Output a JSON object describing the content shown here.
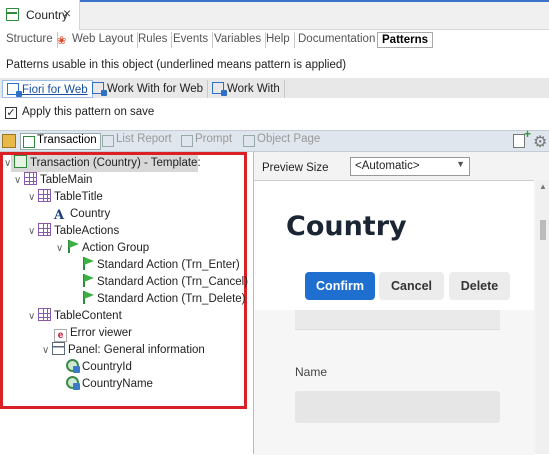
{
  "document_tab": {
    "title": "Country",
    "close_icon": "×"
  },
  "designer_tabs": [
    "Structure",
    "Web Layout",
    "Rules",
    "Events",
    "Variables",
    "Help",
    "Documentation",
    "Patterns"
  ],
  "patterns_caption": "Patterns usable in this object (underlined means pattern is applied)",
  "pattern_tabs": [
    "Fiori for Web",
    "Work With for Web",
    "Work With"
  ],
  "apply_checkbox": {
    "label": "Apply this pattern on save",
    "checked": true,
    "mark": "✓"
  },
  "editor_tabs": [
    "Transaction",
    "List Report",
    "Prompt",
    "Object Page"
  ],
  "tree": {
    "root": "Transaction (Country) - Template:",
    "nodes": [
      "TableMain",
      "TableTitle",
      "Country",
      "TableActions",
      "Action Group",
      "Standard Action (Trn_Enter)",
      "Standard Action (Trn_Cancel)",
      "Standard Action (Trn_Delete)",
      "TableContent",
      "Error viewer",
      "Panel: General information",
      "CountryId",
      "CountryName"
    ]
  },
  "preview": {
    "size_label": "Preview Size",
    "size_value": "<Automatic>",
    "form_title": "Country",
    "buttons": {
      "confirm": "Confirm",
      "cancel": "Cancel",
      "delete": "Delete"
    },
    "field_label": "Name"
  },
  "colors": {
    "highlight": "#d92027",
    "primary": "#1f6fd1",
    "tab_accent": "#3a73c8"
  }
}
